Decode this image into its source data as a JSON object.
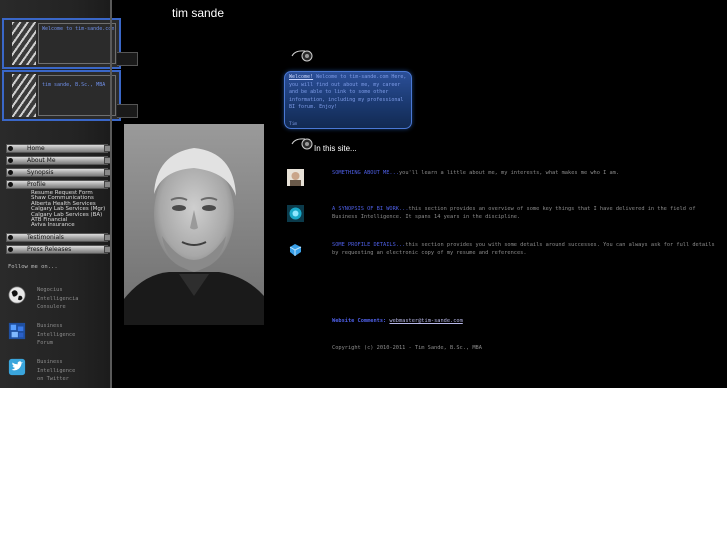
{
  "site": {
    "title": "tim sande"
  },
  "banners": [
    {
      "text": "Welcome to tim-sande.com"
    },
    {
      "text": "tim sande, B.Sc., MBA"
    }
  ],
  "nav": {
    "home": "Home",
    "about": "About Me",
    "synopsis": "Synopsis",
    "profile": "Profile",
    "profile_sub": [
      "Resume Request Form",
      "Shaw Communications",
      "Alberta Health Services",
      "Calgary Lab Services (Mgr)",
      "Calgary Lab Services (BA)",
      "ATB Financial",
      "Aviva Insurance"
    ],
    "testimonials": "Testimonials",
    "press": "Press Releases"
  },
  "follow": {
    "label": "Follow me on...",
    "items": [
      {
        "icon": "globe-icon",
        "lines": [
          "Negocius",
          "Intelligencia",
          "Consulere"
        ]
      },
      {
        "icon": "bi-forum-icon",
        "lines": [
          "Business",
          "Intelligence",
          "Forum"
        ]
      },
      {
        "icon": "twitter-icon",
        "lines": [
          "Business",
          "Intelligence",
          "on Twitter"
        ]
      }
    ]
  },
  "welcome": {
    "lead": "Welcome!",
    "body": " Welcome to tim-sande.com Here, you will find out about me, my career and be able to link to some other information, including my professional BI forum. Enjoy!",
    "sign": "Tim"
  },
  "in_site": {
    "heading": "In this site..."
  },
  "sections": [
    {
      "link": "SOMETHING ABOUT ME...",
      "text": "you'll learn a little about me, my interests, what makes me who I am."
    },
    {
      "link": "A SYNOPSIS OF BI WORK...",
      "text": "this section provides an overview of some key things that I have delivered in the field of Business Intelligence. It spans 14 years in the discipline."
    },
    {
      "link": "SOME PROFILE DETAILS...",
      "text": "this section provides you with some details around successes. You can always ask for full details by requesting an electronic copy of my resume and references."
    }
  ],
  "footer": {
    "webmaster_label": "Website Comments:",
    "email": "webmaster@tim-sande.com",
    "copyright": "Copyright (c) 2010-2011 - Tim Sande, B.Sc., MBA"
  },
  "colors": {
    "link_blue": "#4e5fe6",
    "banner_border": "#3a67c8",
    "welcome_bg": "#1a386e"
  }
}
